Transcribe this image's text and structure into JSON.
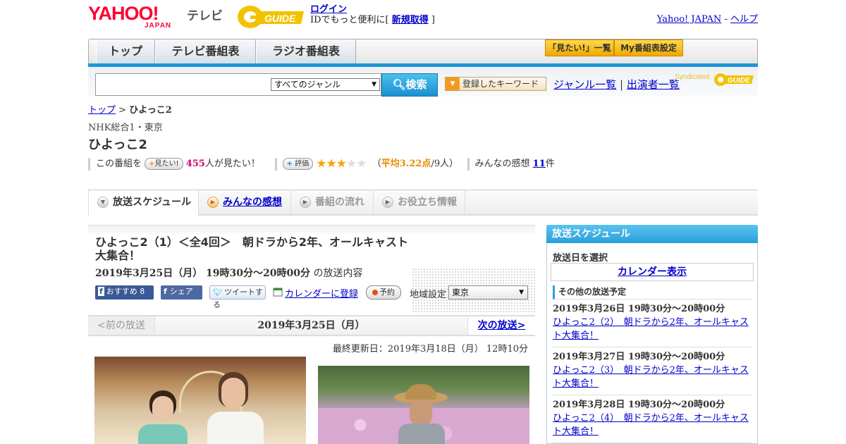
{
  "header": {
    "yahoo_logo": "YAHOO!",
    "yahoo_logo_sub": "JAPAN",
    "tv_label": "テレビ",
    "gguide_logo": "GUIDE",
    "login_link": "ログイン",
    "login_note_prefix": "IDでもっと便利に[ ",
    "signup_link": "新規取得",
    "login_note_suffix": " ]",
    "yahoo_japan_link": "Yahoo! JAPAN",
    "separator": " - ",
    "help_link": "ヘルプ"
  },
  "nav": {
    "tabs": [
      "トップ",
      "テレビ番組表",
      "ラジオ番組表"
    ],
    "mitai_list": "「見たい!」一覧",
    "my_settings": "My番組表設定"
  },
  "search": {
    "value": "",
    "genre": "すべてのジャンル",
    "button": "検索",
    "keyword_button": "登録したキーワード",
    "genre_list_link": "ジャンル一覧",
    "divider": "|",
    "performer_list_link": "出演者一覧",
    "syndicated": "Syndicated"
  },
  "breadcrumb": {
    "home": "トップ",
    "sep": " > ",
    "current": "ひよっこ2"
  },
  "channel": "NHK総合1・東京",
  "title": "ひよっこ2",
  "stats": {
    "prefix": "この番組を",
    "mitai_button": "見たい!",
    "count": "455",
    "count_suffix": "人が見たい！",
    "rating_button": "評価",
    "avg_open": "（",
    "avg_label": "平均3.22点",
    "avg_people": "/9人）",
    "reviews_label": "みんなの感想",
    "reviews_count": "11",
    "reviews_suffix": "件"
  },
  "rating": {
    "value": 3.22,
    "max": 5
  },
  "content_tabs": [
    "放送スケジュール",
    "みんなの感想",
    "番組の流れ",
    "お役立ち情報"
  ],
  "episode": {
    "title": "ひよっこ2（1）＜全4回＞　朝ドラから2年、オールキャスト大集合！",
    "airtime": "2019年3月25日（月） 19時30分～20時00分",
    "airtime_suffix": " の放送内容",
    "fb_recommend": "おすすめ 8",
    "fb_share": "シェア",
    "tweet": "ツイートする",
    "calendar_register": "カレンダーに登録",
    "reserve": "予約",
    "region_label": "地域設定",
    "region_value": "東京"
  },
  "pager": {
    "prev": "<前の放送",
    "date": "2019年3月25日（月）",
    "next": "次の放送>"
  },
  "updated": "最終更新日：2019年3月18日（月） 12時10分",
  "sidebar": {
    "title": "放送スケジュール",
    "select_label": "放送日を選択",
    "calendar_button": "カレンダー表示",
    "other_title": "その他の放送予定",
    "items": [
      {
        "date": "2019年3月26日 19時30分～20時00分",
        "title": "ひよっこ2（2）　朝ドラから2年、オールキャスト大集合！"
      },
      {
        "date": "2019年3月27日 19時30分～20時00分",
        "title": "ひよっこ2（3）　朝ドラから2年、オールキャスト大集合！"
      },
      {
        "date": "2019年3月28日 19時30分～20時00分",
        "title": "ひよっこ2（4）　朝ドラから2年、オールキャスト大集合！"
      }
    ]
  },
  "colors": {
    "accent_blue": "#1e96d8",
    "yahoo_red": "#ff0033",
    "gguide_yellow": "#f2c200",
    "pink": "#d6006a",
    "star": "#f0a800"
  }
}
